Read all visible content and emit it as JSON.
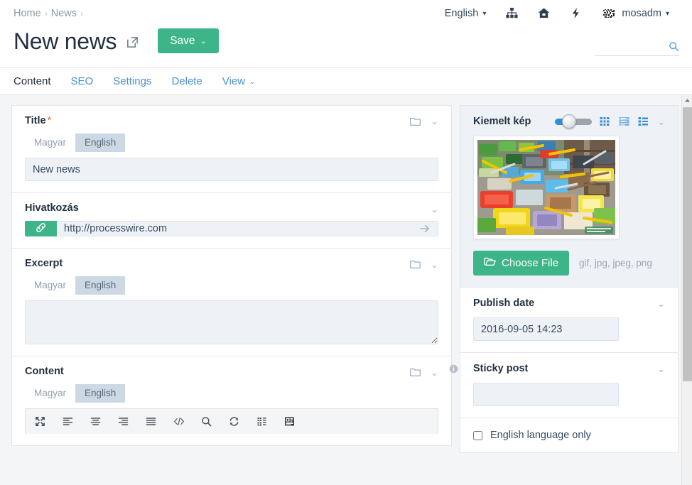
{
  "header": {
    "breadcrumb": [
      {
        "label": "Home"
      },
      {
        "label": "News"
      }
    ],
    "breadcrumb_separator": "›",
    "page_title": "New news",
    "external_link_icon": "external-link-icon",
    "save_label": "Save",
    "save_caret": "⌄",
    "accent_green": "#3eb489",
    "link_blue": "#4a8fd1",
    "top_nav": [
      {
        "label": "English",
        "icon": "",
        "caret": "▾",
        "name": "language-selector"
      },
      {
        "label": "",
        "icon": "sitemap-icon",
        "caret": "",
        "name": "sitemap-button"
      },
      {
        "label": "",
        "icon": "home-icon",
        "caret": "",
        "name": "home-button"
      },
      {
        "label": "",
        "icon": "bolt-icon",
        "caret": "",
        "name": "flash-button"
      },
      {
        "label": "mosadm",
        "icon": "avatar",
        "caret": "▾",
        "name": "user-menu"
      }
    ],
    "search": {
      "value": "",
      "placeholder": "",
      "icon": "search-icon"
    }
  },
  "tabs": [
    {
      "label": "Content",
      "active": true
    },
    {
      "label": "SEO",
      "active": false
    },
    {
      "label": "Settings",
      "active": false
    },
    {
      "label": "Delete",
      "active": false
    },
    {
      "label": "View",
      "active": false,
      "caret": "⌄"
    }
  ],
  "main": {
    "title_field": {
      "label": "Title",
      "required_marker": "*",
      "folder_icon": "folder-icon",
      "collapse_caret": "⌄",
      "languages": [
        {
          "label": "Magyar",
          "active": false
        },
        {
          "label": "English",
          "active": true
        }
      ],
      "value": "New news",
      "placeholder": ""
    },
    "link_field": {
      "label": "Hivatkozás",
      "collapse_caret": "⌄",
      "button_icon": "link-icon",
      "value": "http://processwire.com",
      "placeholder": "",
      "goto_icon": "arrow-right-icon"
    },
    "excerpt_field": {
      "label": "Excerpt",
      "folder_icon": "folder-icon",
      "collapse_caret": "⌄",
      "languages": [
        {
          "label": "Magyar",
          "active": false
        },
        {
          "label": "English",
          "active": true
        }
      ],
      "value": "",
      "placeholder": ""
    },
    "content_field": {
      "label": "Content",
      "folder_icon": "folder-icon",
      "collapse_caret": "⌄",
      "languages": [
        {
          "label": "Magyar",
          "active": false
        },
        {
          "label": "English",
          "active": true
        }
      ],
      "toolbar": [
        {
          "name": "maximize-icon",
          "title": "Maximize"
        },
        {
          "name": "align-left-icon",
          "title": "Align left"
        },
        {
          "name": "align-center-icon",
          "title": "Align center"
        },
        {
          "name": "align-right-icon",
          "title": "Align right"
        },
        {
          "name": "align-justify-icon",
          "title": "Justify"
        },
        {
          "name": "source-code-icon",
          "title": "Source"
        },
        {
          "name": "search-icon",
          "title": "Find"
        },
        {
          "name": "refresh-icon",
          "title": "Refresh"
        },
        {
          "name": "blocks-icon",
          "title": "Show blocks"
        },
        {
          "name": "image-manager-icon",
          "title": "Images"
        }
      ]
    }
  },
  "sidebar": {
    "image_field": {
      "label": "Kiemelt kép",
      "collapse_caret": "⌄",
      "slider": {
        "name": "thumbnail-size-slider",
        "value": 22
      },
      "view_modes": [
        {
          "name": "grid-view-icon",
          "active": false
        },
        {
          "name": "list-view-icon",
          "active": true
        },
        {
          "name": "detail-view-icon",
          "active": false
        }
      ],
      "thumbnail_alt": "paint trays and rollers",
      "choose_file_label": "Choose File",
      "choose_file_icon": "folder-open-icon",
      "file_types_hint": "gif, jpg, jpeg, png"
    },
    "publish_date_field": {
      "label": "Publish date",
      "collapse_caret": "⌄",
      "value": "2016-09-05 14:23",
      "placeholder": ""
    },
    "sticky_post_field": {
      "label": "Sticky post",
      "info_icon": "info-circle-icon",
      "collapse_caret": "⌄",
      "value": "",
      "placeholder": ""
    },
    "language_only_checkbox": {
      "label": "English language only",
      "checked": false
    }
  },
  "scrollbar": {
    "up_arrow_icon": "caret-up-icon"
  }
}
